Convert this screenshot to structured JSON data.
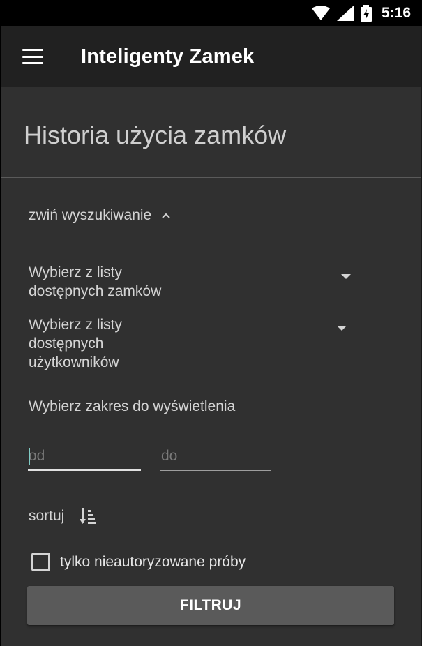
{
  "status_bar": {
    "time": "5:16",
    "icons": [
      "wifi-icon",
      "signal-icon",
      "battery-charging-icon"
    ]
  },
  "app_bar": {
    "title": "Inteligenty Zamek",
    "menu_icon": "hamburger-menu-icon"
  },
  "page": {
    "title": "Historia użycia zamków"
  },
  "search": {
    "collapse_label": "zwiń wyszukiwanie",
    "locks_spinner": "Wybierz z listy dostępnych zamków",
    "users_spinner": "Wybierz z listy dostępnych użytkowników",
    "range_label": "Wybierz zakres do wyświetlenia",
    "from_placeholder": "od",
    "to_placeholder": "do",
    "sort_label": "sortuj",
    "sort_icon": "sort-descending-icon",
    "unauthorized_only_label": "tylko nieautoryzowane próby",
    "unauthorized_only_checked": false,
    "filter_button": "FILTRUJ"
  },
  "colors": {
    "background": "#303030",
    "app_bar": "#212121",
    "status_bar": "#000000",
    "button": "#5a5a5a",
    "cursor_accent": "#80cbc4"
  }
}
